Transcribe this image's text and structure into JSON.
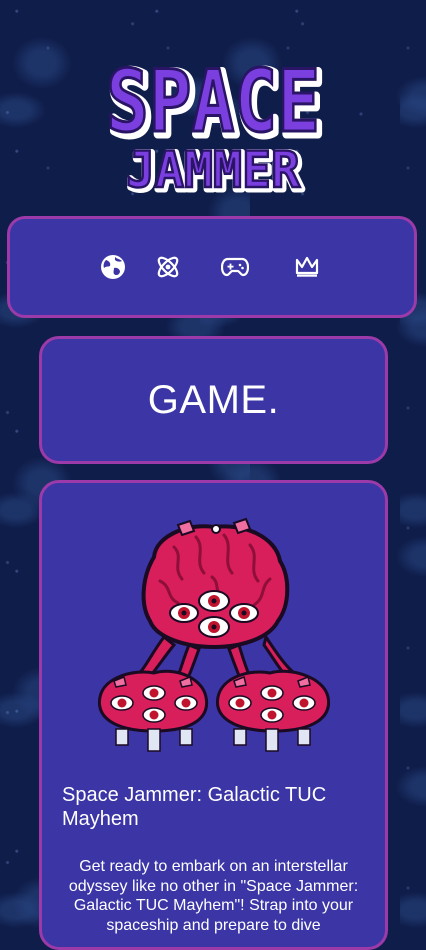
{
  "logo": {
    "line1": "SPACE",
    "line2": "JAMMER",
    "colors": {
      "fill": "#7b3fe0",
      "highlight": "#b888ff",
      "outline": "#ffffff",
      "shadow": "#3a1f7a"
    }
  },
  "nav": {
    "items": [
      {
        "icon": "globe-icon",
        "label": ""
      },
      {
        "icon": "atom-icon",
        "label": ""
      },
      {
        "icon": "gamepad-icon",
        "label": ""
      },
      {
        "icon": "crown-icon",
        "label": ""
      }
    ]
  },
  "section": {
    "title": "GAME."
  },
  "game": {
    "image": "brain-monster-sprite",
    "title": "Space Jammer: Galactic TUC Mayhem",
    "description": "Get ready to embark on an interstellar odyssey like no other in \"Space Jammer: Galactic TUC Mayhem\"! Strap into your spaceship and prepare to dive"
  },
  "colors": {
    "background": "#0f1d4a",
    "card": "#3b35a6",
    "card_border": "#9b3aa8",
    "monster": "#d81e5b",
    "monster_dark": "#8e0f3a"
  }
}
